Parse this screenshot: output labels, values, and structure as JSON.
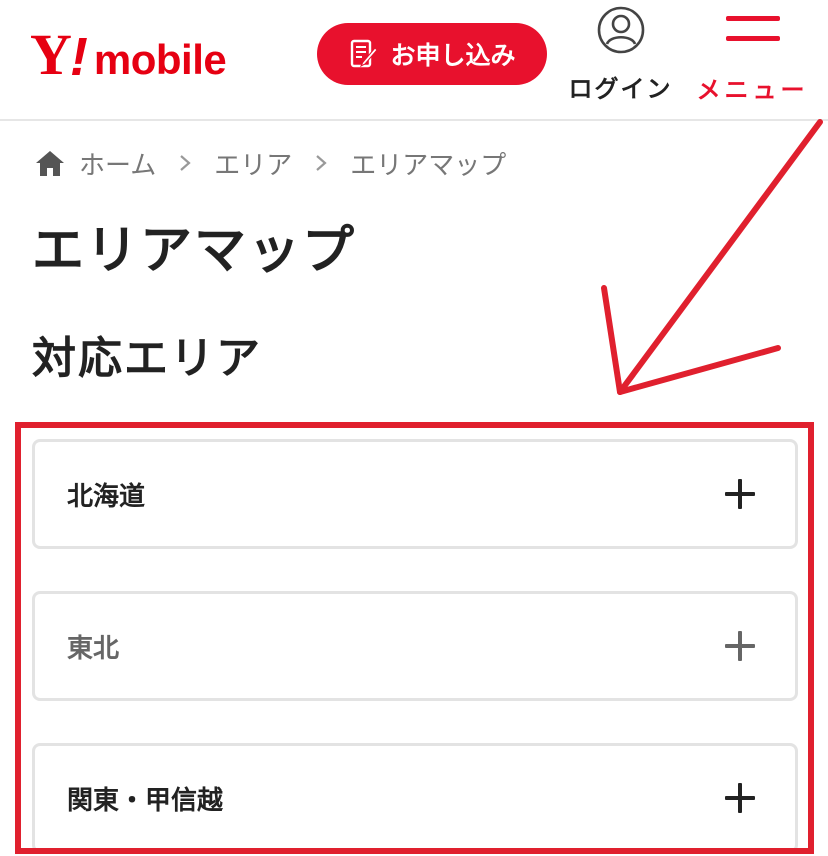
{
  "header": {
    "logo": {
      "y": "Y",
      "bang": "!",
      "mobile": "mobile"
    },
    "apply_button": "お申し込み",
    "login_label": "ログイン",
    "menu_label": "メニュー"
  },
  "breadcrumb": [
    "ホーム",
    "エリア",
    "エリアマップ"
  ],
  "page_title": "エリアマップ",
  "section_title": "対応エリア",
  "accordion": [
    {
      "label": "北海道",
      "state": "collapsed"
    },
    {
      "label": "東北",
      "state": "collapsed"
    },
    {
      "label": "関東・甲信越",
      "state": "collapsed"
    }
  ],
  "colors": {
    "brand_red": "#e8112d",
    "annotation_red": "#e0202e",
    "border_gray": "#e3e3e3",
    "text_dark": "#222222"
  },
  "icons": [
    "home-icon",
    "chevron-right-icon",
    "pencil-form-icon",
    "user-circle-icon",
    "hamburger-icon",
    "plus-icon"
  ]
}
